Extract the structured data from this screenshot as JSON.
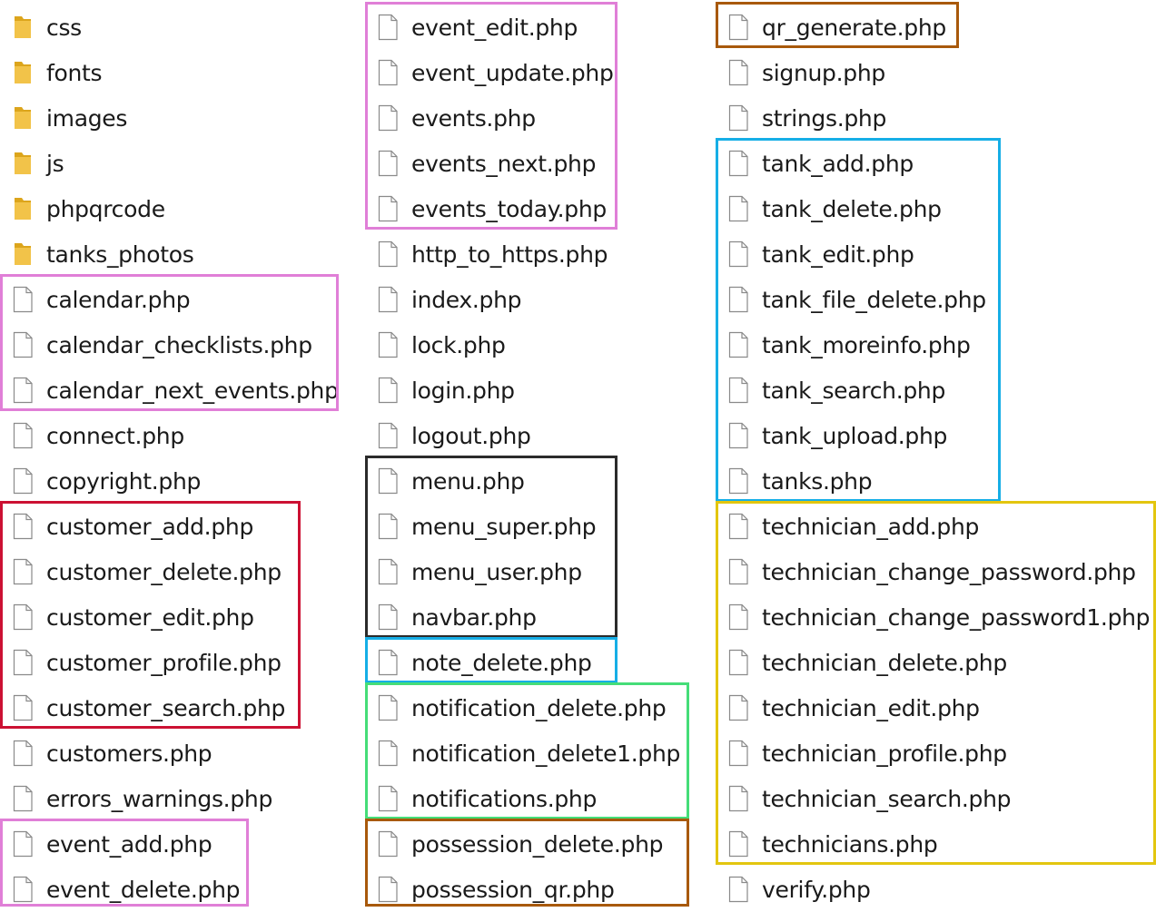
{
  "colors": {
    "folder": "#f2c349",
    "folder_dark": "#dca51c",
    "file_border": "#8a8a8a",
    "pink": "#e07fd7",
    "red": "#cc1133",
    "black": "#2b2b2b",
    "blue": "#16aee6",
    "green": "#45dd78",
    "brown": "#a8590b",
    "yellow": "#e3c60f"
  },
  "columns": [
    {
      "items": [
        {
          "name": "css",
          "type": "folder"
        },
        {
          "name": "fonts",
          "type": "folder"
        },
        {
          "name": "images",
          "type": "folder"
        },
        {
          "name": "js",
          "type": "folder"
        },
        {
          "name": "phpqrcode",
          "type": "folder"
        },
        {
          "name": "tanks_photos",
          "type": "folder"
        },
        {
          "name": "calendar.php",
          "type": "file"
        },
        {
          "name": "calendar_checklists.php",
          "type": "file"
        },
        {
          "name": "calendar_next_events.php",
          "type": "file"
        },
        {
          "name": "connect.php",
          "type": "file"
        },
        {
          "name": "copyright.php",
          "type": "file"
        },
        {
          "name": "customer_add.php",
          "type": "file"
        },
        {
          "name": "customer_delete.php",
          "type": "file"
        },
        {
          "name": "customer_edit.php",
          "type": "file"
        },
        {
          "name": "customer_profile.php",
          "type": "file"
        },
        {
          "name": "customer_search.php",
          "type": "file"
        },
        {
          "name": "customers.php",
          "type": "file"
        },
        {
          "name": "errors_warnings.php",
          "type": "file"
        },
        {
          "name": "event_add.php",
          "type": "file"
        },
        {
          "name": "event_delete.php",
          "type": "file"
        }
      ]
    },
    {
      "items": [
        {
          "name": "event_edit.php",
          "type": "file"
        },
        {
          "name": "event_update.php",
          "type": "file"
        },
        {
          "name": "events.php",
          "type": "file"
        },
        {
          "name": "events_next.php",
          "type": "file"
        },
        {
          "name": "events_today.php",
          "type": "file"
        },
        {
          "name": "http_to_https.php",
          "type": "file"
        },
        {
          "name": "index.php",
          "type": "file"
        },
        {
          "name": "lock.php",
          "type": "file"
        },
        {
          "name": "login.php",
          "type": "file"
        },
        {
          "name": "logout.php",
          "type": "file"
        },
        {
          "name": "menu.php",
          "type": "file"
        },
        {
          "name": "menu_super.php",
          "type": "file"
        },
        {
          "name": "menu_user.php",
          "type": "file"
        },
        {
          "name": "navbar.php",
          "type": "file"
        },
        {
          "name": "note_delete.php",
          "type": "file"
        },
        {
          "name": "notification_delete.php",
          "type": "file"
        },
        {
          "name": "notification_delete1.php",
          "type": "file"
        },
        {
          "name": "notifications.php",
          "type": "file"
        },
        {
          "name": "possession_delete.php",
          "type": "file"
        },
        {
          "name": "possession_qr.php",
          "type": "file"
        }
      ]
    },
    {
      "items": [
        {
          "name": "qr_generate.php",
          "type": "file"
        },
        {
          "name": "signup.php",
          "type": "file"
        },
        {
          "name": "strings.php",
          "type": "file"
        },
        {
          "name": "tank_add.php",
          "type": "file"
        },
        {
          "name": "tank_delete.php",
          "type": "file"
        },
        {
          "name": "tank_edit.php",
          "type": "file"
        },
        {
          "name": "tank_file_delete.php",
          "type": "file"
        },
        {
          "name": "tank_moreinfo.php",
          "type": "file"
        },
        {
          "name": "tank_search.php",
          "type": "file"
        },
        {
          "name": "tank_upload.php",
          "type": "file"
        },
        {
          "name": "tanks.php",
          "type": "file"
        },
        {
          "name": "technician_add.php",
          "type": "file"
        },
        {
          "name": "technician_change_password.php",
          "type": "file"
        },
        {
          "name": "technician_change_password1.php",
          "type": "file"
        },
        {
          "name": "technician_delete.php",
          "type": "file"
        },
        {
          "name": "technician_edit.php",
          "type": "file"
        },
        {
          "name": "technician_profile.php",
          "type": "file"
        },
        {
          "name": "technician_search.php",
          "type": "file"
        },
        {
          "name": "technicians.php",
          "type": "file"
        },
        {
          "name": "verify.php",
          "type": "file"
        }
      ]
    }
  ],
  "groups": [
    {
      "column": 0,
      "start": 6,
      "end": 8,
      "color": "pink"
    },
    {
      "column": 0,
      "start": 11,
      "end": 15,
      "color": "red"
    },
    {
      "column": 0,
      "start": 18,
      "end": 19,
      "color": "pink"
    },
    {
      "column": 1,
      "start": 0,
      "end": 4,
      "color": "pink"
    },
    {
      "column": 1,
      "start": 10,
      "end": 13,
      "color": "black"
    },
    {
      "column": 1,
      "start": 14,
      "end": 14,
      "color": "blue"
    },
    {
      "column": 1,
      "start": 15,
      "end": 17,
      "color": "green"
    },
    {
      "column": 1,
      "start": 18,
      "end": 19,
      "color": "brown"
    },
    {
      "column": 2,
      "start": 0,
      "end": 0,
      "color": "brown"
    },
    {
      "column": 2,
      "start": 3,
      "end": 10,
      "color": "blue"
    },
    {
      "column": 2,
      "start": 11,
      "end": 18,
      "color": "yellow"
    }
  ]
}
